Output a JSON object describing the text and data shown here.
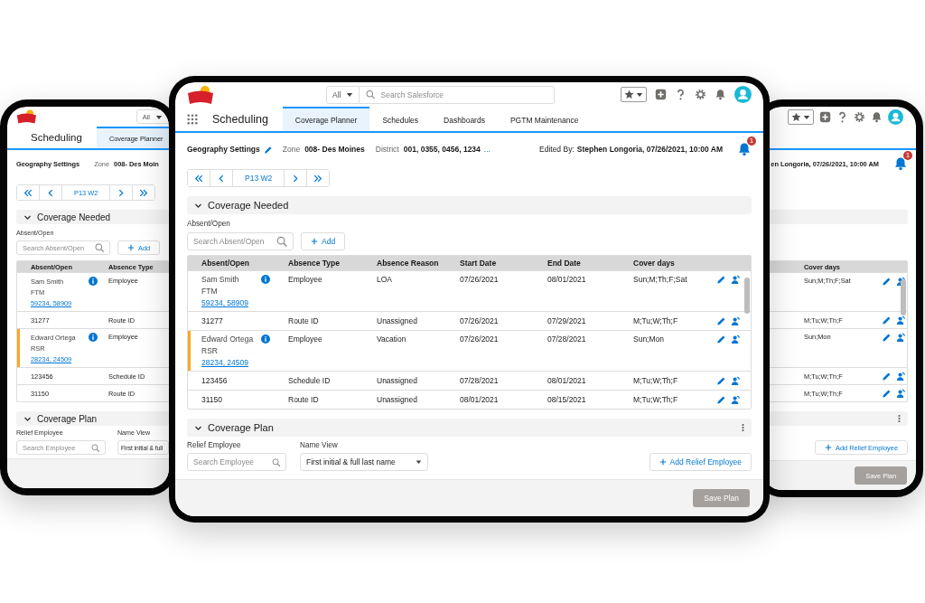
{
  "left_tablet": {
    "header": {
      "search_scope": "All"
    },
    "nav": {
      "app_name": "Scheduling",
      "tabs": [
        {
          "label": "Coverage Planner",
          "selected": true
        }
      ]
    },
    "geography": {
      "title": "Geography Settings",
      "zone_label": "Zone",
      "zone": "008- Des Moin"
    },
    "pager": {
      "period": "P13 W2"
    },
    "coverage_needed": {
      "title": "Coverage Needed",
      "expanded": true,
      "search_label": "Absent/Open",
      "search_placeholder": "Search Absent/Open",
      "add_button": "Add",
      "table": {
        "columns": [
          "Absent/Open",
          "Absence Type"
        ],
        "row_actions": false,
        "rows": [
          {
            "kind": "employee",
            "flagged": false,
            "cells": [
              {
                "name": "Sam Smith",
                "role": "FTM",
                "ids": "59234, 58909"
              },
              "Employee"
            ]
          },
          {
            "kind": "id",
            "flagged": false,
            "cells": [
              "31277",
              "Route ID"
            ]
          },
          {
            "kind": "employee",
            "flagged": true,
            "cells": [
              {
                "name": "Edward Ortega",
                "role": "RSR",
                "ids": "28234, 24509"
              },
              "Employee"
            ]
          },
          {
            "kind": "id",
            "flagged": false,
            "cells": [
              "123456",
              "Schedule ID"
            ]
          },
          {
            "kind": "id",
            "flagged": false,
            "cells": [
              "31150",
              "Route ID"
            ]
          }
        ]
      }
    },
    "coverage_plan": {
      "title": "Coverage Plan",
      "expanded": true,
      "relief_label": "Relief Employee",
      "relief_placeholder": "Search Employee",
      "name_view_label": "Name View",
      "name_view_value": "First initial & full"
    }
  },
  "main_tablet": {
    "header": {
      "search_scope": "All",
      "search_placeholder": "Search Salesforce"
    },
    "nav": {
      "app_name": "Scheduling",
      "tabs": [
        {
          "label": "Coverage Planner",
          "selected": true
        },
        {
          "label": "Schedules",
          "selected": false
        },
        {
          "label": "Dashboards",
          "selected": false
        },
        {
          "label": "PGTM Maintenance",
          "selected": false
        }
      ]
    },
    "geography": {
      "title": "Geography Settings",
      "zone_label": "Zone",
      "zone": "008- Des Moines",
      "district_label": "District",
      "district": "001, 0355, 0456, 1234",
      "district_more": "...",
      "edited_label": "Edited By:",
      "edited_value": "Stephen Longoria, 07/26/2021, 10:00 AM",
      "notification_count": "1"
    },
    "pager": {
      "period": "P13 W2"
    },
    "coverage_needed": {
      "title": "Coverage Needed",
      "expanded": true,
      "search_label": "Absent/Open",
      "search_placeholder": "Search Absent/Open",
      "add_button": "Add",
      "table": {
        "columns": [
          "Absent/Open",
          "Absence Type",
          "Absence Reason",
          "Start Date",
          "End Date",
          "Cover days"
        ],
        "row_actions": true,
        "rows": [
          {
            "kind": "employee",
            "flagged": false,
            "cells": [
              {
                "name": "Sam Smith",
                "role": "FTM",
                "ids": "59234, 58909"
              },
              "Employee",
              "LOA",
              "07/26/2021",
              "08/01/2021",
              "Sun;M;Th;F;Sat"
            ]
          },
          {
            "kind": "id",
            "flagged": false,
            "cells": [
              "31277",
              "Route ID",
              "Unassigned",
              "07/26/2021",
              "07/29/2021",
              "M;Tu;W;Th;F"
            ]
          },
          {
            "kind": "employee",
            "flagged": true,
            "cells": [
              {
                "name": "Edward Ortega",
                "role": "RSR",
                "ids": "28234, 24509"
              },
              "Employee",
              "Vacation",
              "07/26/2021",
              "07/28/2021",
              "Sun;Mon"
            ]
          },
          {
            "kind": "id",
            "flagged": false,
            "cells": [
              "123456",
              "Schedule ID",
              "Unassigned",
              "07/28/2021",
              "08/01/2021",
              "M;Tu;W;Th;F"
            ]
          },
          {
            "kind": "id",
            "flagged": false,
            "cells": [
              "31150",
              "Route ID",
              "Unassigned",
              "08/01/2021",
              "08/15/2021",
              "M;Tu;W;Th;F"
            ]
          }
        ]
      }
    },
    "coverage_plan": {
      "title": "Coverage Plan",
      "expanded": true,
      "relief_label": "Relief Employee",
      "relief_placeholder": "Search Employee",
      "name_view_label": "Name View",
      "name_view_value": "First initial & full last name",
      "add_relief_button": "Add Relief Employee"
    },
    "footer": {
      "save_button": "Save Plan",
      "save_disabled": true
    }
  },
  "right_tablet": {
    "geography": {
      "edited_value": "en Longoria, 07/26/2021, 10:00 AM",
      "notification_count": "1"
    },
    "coverage_needed": {
      "table": {
        "columns": [
          "Cover days"
        ],
        "row_actions": true,
        "rows": [
          {
            "kind": "employee",
            "cells": [
              "Sun;M;Th;F;Sat"
            ]
          },
          {
            "kind": "id",
            "cells": [
              "M;Tu;W;Th;F"
            ]
          },
          {
            "kind": "employee",
            "cells": [
              "Sun;Mon"
            ]
          },
          {
            "kind": "id",
            "cells": [
              "M;Tu;W;Th;F"
            ]
          },
          {
            "kind": "id",
            "cells": [
              "M;Tu;W;Th;F"
            ]
          }
        ]
      }
    },
    "coverage_plan": {
      "add_relief_button": "Add Relief Employee"
    },
    "footer": {
      "save_button": "Save Plan",
      "save_disabled": true
    }
  }
}
